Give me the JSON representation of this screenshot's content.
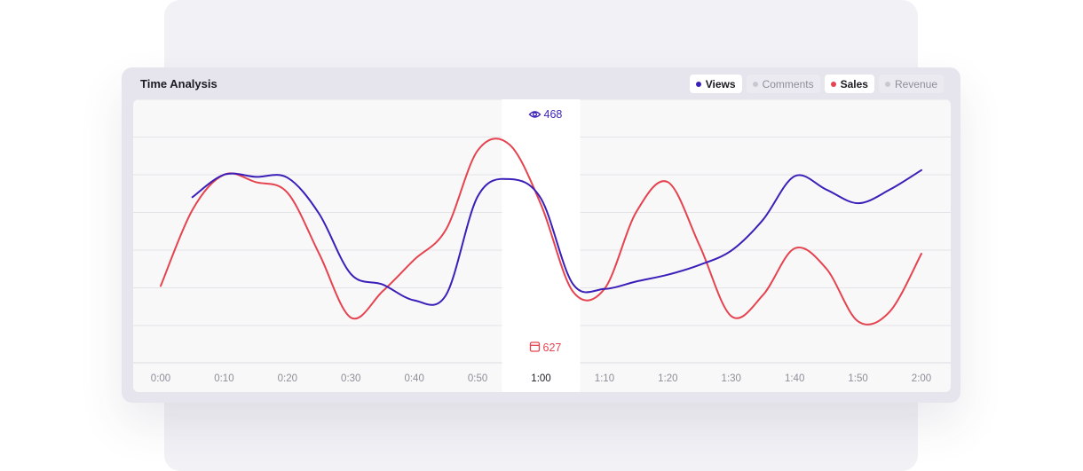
{
  "card": {
    "title": "Time Analysis"
  },
  "legend": [
    {
      "label": "Views",
      "active": true,
      "color": "#3b1fb8"
    },
    {
      "label": "Comments",
      "active": false,
      "color": "#c9c7d0"
    },
    {
      "label": "Sales",
      "active": true,
      "color": "#e5434f"
    },
    {
      "label": "Revenue",
      "active": false,
      "color": "#c9c7d0"
    }
  ],
  "tooltip": {
    "x_label": "1:00",
    "views_value": "468",
    "sales_value": "627",
    "views_icon": "eye-icon",
    "sales_icon": "calendar-icon"
  },
  "chart_data": {
    "type": "line",
    "x": [
      "0:00",
      "0:05",
      "0:10",
      "0:15",
      "0:20",
      "0:25",
      "0:30",
      "0:35",
      "0:40",
      "0:45",
      "0:50",
      "0:55",
      "1:00",
      "1:05",
      "1:10",
      "1:15",
      "1:20",
      "1:25",
      "1:30",
      "1:35",
      "1:40",
      "1:45",
      "1:50",
      "1:55",
      "2:00"
    ],
    "x_tick_labels": [
      "0:00",
      "0:10",
      "0:20",
      "0:30",
      "0:40",
      "0:50",
      "1:00",
      "1:10",
      "1:20",
      "1:30",
      "1:40",
      "1:50",
      "2:00"
    ],
    "series": [
      {
        "name": "Views",
        "color": "#3b1fb8",
        "values": [
          null,
          470,
          500,
          497,
          496,
          448,
          368,
          354,
          333,
          340,
          471,
          494,
          468,
          355,
          348,
          358,
          367,
          380,
          399,
          440,
          498,
          480,
          462,
          480,
          506
        ]
      },
      {
        "name": "Sales",
        "color": "#e5434f",
        "values": [
          352,
          453,
          500,
          490,
          476,
          395,
          310,
          345,
          387,
          427,
          532,
          540,
          460,
          345,
          348,
          450,
          490,
          406,
          312,
          340,
          402,
          375,
          305,
          318,
          395
        ]
      }
    ],
    "highlight_x": "1:00",
    "grid": true,
    "legend_position": "top-right"
  }
}
